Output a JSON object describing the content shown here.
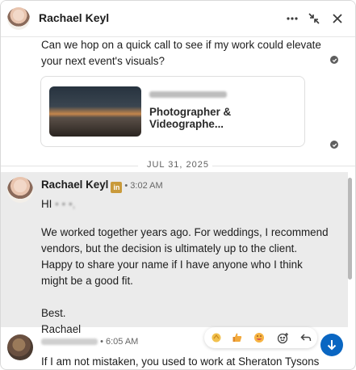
{
  "header": {
    "contact_name": "Rachael Keyl"
  },
  "messages": {
    "first": {
      "text": "Can we hop on a quick call to see if my work could elevate\nyour next event's visuals?"
    },
    "card": {
      "subtitle": "Photographer & Videographe..."
    },
    "date_divider": "JUL 31, 2025",
    "second": {
      "sender": "Rachael Keyl",
      "badge": "in",
      "time": "• 3:02 AM",
      "greeting_prefix": "HI",
      "greeting_blurred": "• • •,",
      "body": "We worked together years ago. For weddings, I recommend\nvendors, but the decision is ultimately up to the client.\nHappy to share your name if I have anyone who I think\nmight be a good fit.\n\nBest.\nRachael"
    },
    "third": {
      "time": "• 6:05 AM",
      "text": "If I am not mistaken, you used to work at Sheraton Tysons"
    }
  },
  "colors": {
    "accent": "#0a66c2",
    "premium_badge": "#c99a3b",
    "highlight_bg": "#ebebeb"
  },
  "icons": {
    "more": "more-icon",
    "minimize": "minimize-icon",
    "close": "close-icon",
    "seen": "seen-check-icon",
    "reactions": [
      "clap-emoji-icon",
      "thumbs-up-emoji-icon",
      "laugh-emoji-icon",
      "add-reaction-icon",
      "reply-icon"
    ],
    "scroll_down": "arrow-down-icon"
  }
}
